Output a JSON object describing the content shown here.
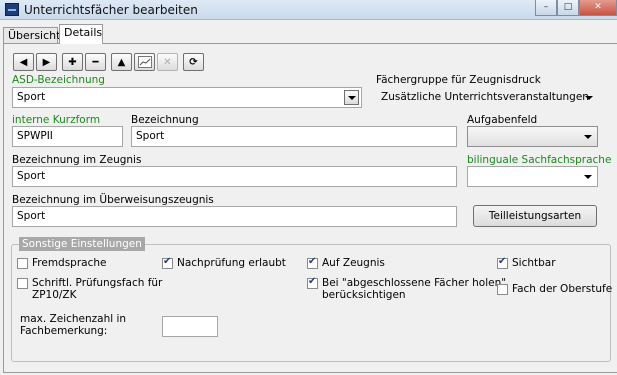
{
  "window": {
    "title": "Unterrichtsfächer bearbeiten"
  },
  "tabs": [
    {
      "label": "Übersicht"
    },
    {
      "label": "Details"
    }
  ],
  "toolbar": {
    "icons": [
      "prev-icon",
      "next-icon",
      "add-icon",
      "remove-icon",
      "up-icon",
      "edit-icon",
      "delete-icon",
      "refresh-icon"
    ]
  },
  "form": {
    "asd_label": "ASD-Bezeichnung",
    "asd_value": "Sport",
    "faechergruppe_label": "Fächergruppe für Zeugnisdruck",
    "faechergruppe_value": "Zusätzliche Unterrichtsveranstaltungen",
    "kurzform_label": "interne Kurzform",
    "kurzform_value": "SPWPII",
    "bezeichnung_label": "Bezeichnung",
    "bezeichnung_value": "Sport",
    "aufgabenfeld_label": "Aufgabenfeld",
    "aufgabenfeld_value": "",
    "zeugnis_label": "Bezeichnung im Zeugnis",
    "zeugnis_value": "Sport",
    "bilingual_label": "bilinguale Sachfachsprache",
    "bilingual_value": "",
    "ueberweisung_label": "Bezeichnung im Überweisungszeugnis",
    "ueberweisung_value": "Sport",
    "teilleistung_button": "Teilleistungsarten"
  },
  "settings": {
    "title": "Sonstige Einstellungen",
    "fremdsprache": {
      "label": "Fremdsprache",
      "checked": false
    },
    "nachpruefung": {
      "label": "Nachprüfung erlaubt",
      "checked": true
    },
    "auf_zeugnis": {
      "label": "Auf Zeugnis",
      "checked": true
    },
    "sichtbar": {
      "label": "Sichtbar",
      "checked": true
    },
    "schriftl_line1": "Schriftl. Prüfungsfach für",
    "schriftl_line2": "ZP10/ZK",
    "abgeschlossene_line1": "Bei \"abgeschlossene Fächer holen\"",
    "abgeschlossene_line2": "berücksichtigen",
    "abgeschlossene_checked": true,
    "oberstufe": {
      "label": "Fach der Oberstufe",
      "checked": false
    },
    "zeichen_line1": "max. Zeichenzahl in",
    "zeichen_line2": "Fachbemerkung:",
    "zeichen_value": ""
  }
}
